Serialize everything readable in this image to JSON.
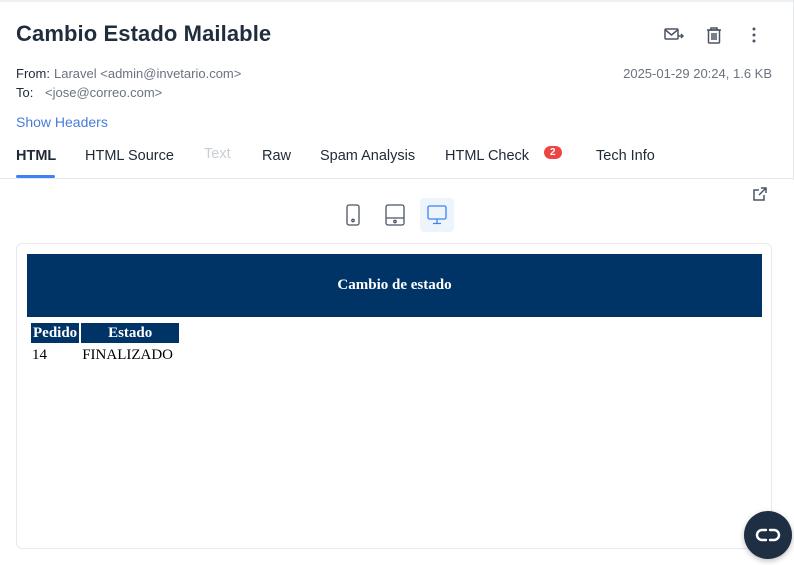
{
  "message": {
    "title": "Cambio Estado Mailable",
    "from_label": "From:",
    "from_value": "Laravel <admin@invetario.com>",
    "to_label": "To:",
    "to_value": "<jose@correo.com>",
    "timestamp_size": "2025-01-29 20:24, 1.6 KB",
    "show_headers": "Show Headers"
  },
  "actions": {
    "icons": [
      "mail-forward-icon",
      "trash-icon",
      "more-vertical-icon"
    ]
  },
  "tabs": [
    {
      "label": "HTML",
      "active": true
    },
    {
      "label": "HTML Source"
    },
    {
      "label": "Text",
      "disabled": true
    },
    {
      "label": "Raw"
    },
    {
      "label": "Spam Analysis"
    },
    {
      "label": "HTML Check",
      "badge": "2"
    },
    {
      "label": "Tech Info"
    }
  ],
  "preview": {
    "devices": [
      "phone",
      "tablet",
      "desktop"
    ],
    "active_device": "desktop",
    "email": {
      "heading": "Cambio de estado",
      "table_headers": [
        "Pedido",
        "Estado"
      ],
      "rows": [
        [
          "14",
          "FINALIZADO"
        ]
      ]
    }
  },
  "colors": {
    "accent": "#3b82f6",
    "email_header_bg": "#003366",
    "badge": "#ef4444",
    "fab_bg": "#1e2e43"
  }
}
